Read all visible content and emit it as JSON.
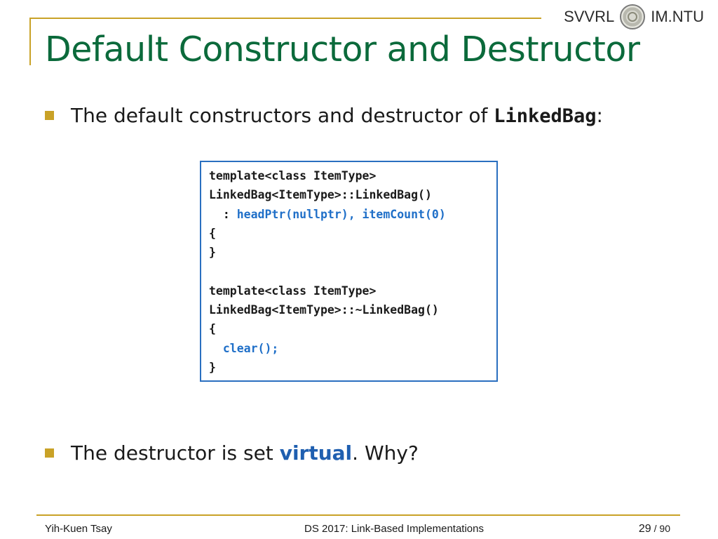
{
  "header": {
    "brand_left": "SVVRL",
    "brand_right": "IM.NTU",
    "title": "Default Constructor and Destructor"
  },
  "bullets": {
    "first_prefix": "The default constructors and destructor of ",
    "first_code": "LinkedBag",
    "first_suffix": ":",
    "second_prefix": "The destructor is set ",
    "second_highlight": "virtual",
    "second_suffix": ". Why?"
  },
  "code": {
    "l1": "template<class ItemType>",
    "l2": "LinkedBag<ItemType>::LinkedBag()",
    "l3_prefix": "  : ",
    "l3_blue": "headPtr(nullptr), itemCount(0)",
    "l4": "{",
    "l5": "}",
    "l6": "",
    "l7": "template<class ItemType>",
    "l8": "LinkedBag<ItemType>::~LinkedBag()",
    "l9": "{",
    "l10_prefix": "  ",
    "l10_blue": "clear();",
    "l11": "}"
  },
  "footer": {
    "author": "Yih-Kuen Tsay",
    "course": "DS 2017: Link-Based Implementations",
    "page": "29",
    "total": "/ 90"
  },
  "colors": {
    "accent_gold": "#c9a227",
    "title_green": "#0b6a3b",
    "code_blue": "#1f6fc8"
  }
}
